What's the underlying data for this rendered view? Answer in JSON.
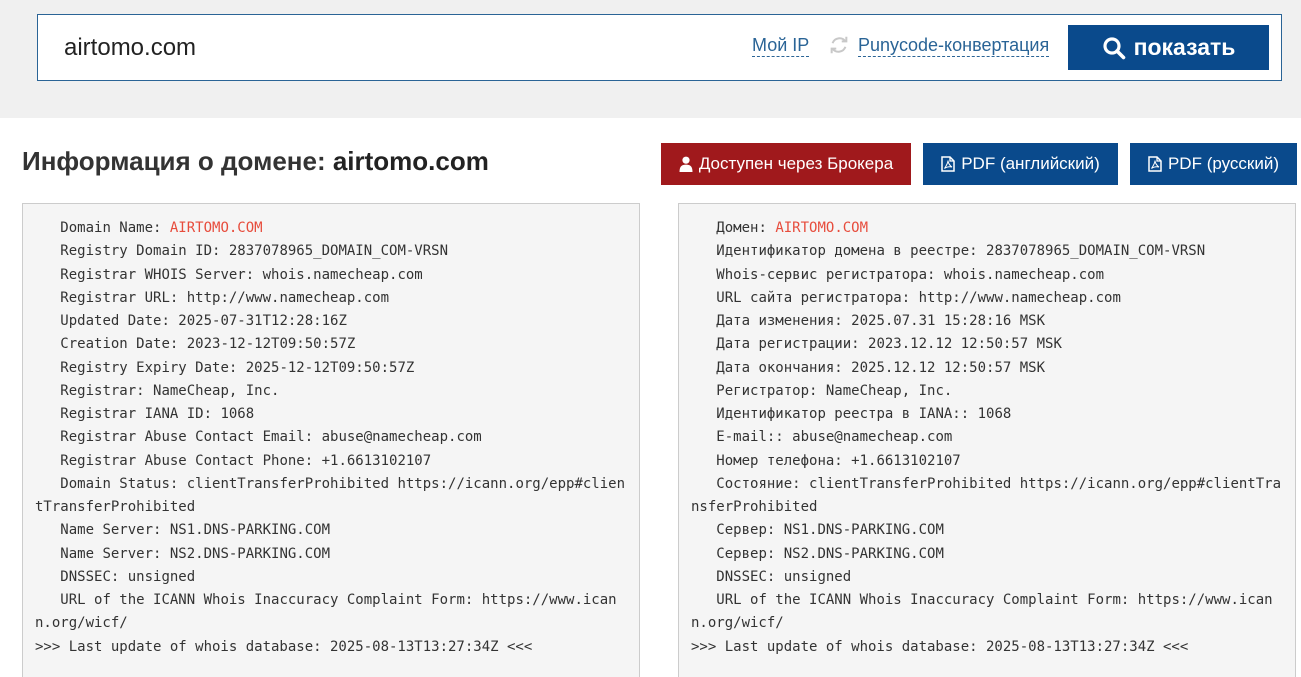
{
  "search": {
    "value": "airtomo.com",
    "my_ip_label": "Мой IP",
    "punycode_label": "Punycode-конвертация",
    "show_label": "показать"
  },
  "header": {
    "title_prefix": "Информация о домене: ",
    "domain": "airtomo.com"
  },
  "actions": {
    "broker_label": "Доступен через Брокера",
    "pdf_en_label": "PDF (английский)",
    "pdf_ru_label": "PDF (русский)"
  },
  "whois_en": {
    "domain_name_key": "   Domain Name: ",
    "domain_name_value": "AIRTOMO.COM",
    "lines": [
      "   Registry Domain ID: 2837078965_DOMAIN_COM-VRSN",
      "   Registrar WHOIS Server: whois.namecheap.com",
      "   Registrar URL: http://www.namecheap.com",
      "   Updated Date: 2025-07-31T12:28:16Z",
      "   Creation Date: 2023-12-12T09:50:57Z",
      "   Registry Expiry Date: 2025-12-12T09:50:57Z",
      "   Registrar: NameCheap, Inc.",
      "   Registrar IANA ID: 1068",
      "   Registrar Abuse Contact Email: abuse@namecheap.com",
      "   Registrar Abuse Contact Phone: +1.6613102107",
      "   Domain Status: clientTransferProhibited https://icann.org/epp#clientTransferProhibited",
      "   Name Server: NS1.DNS-PARKING.COM",
      "   Name Server: NS2.DNS-PARKING.COM",
      "   DNSSEC: unsigned",
      "   URL of the ICANN Whois Inaccuracy Complaint Form: https://www.icann.org/wicf/",
      ">>> Last update of whois database: 2025-08-13T13:27:34Z <<<"
    ]
  },
  "whois_ru": {
    "domain_name_key": "   Домен: ",
    "domain_name_value": "AIRTOMO.COM",
    "lines": [
      "   Идентификатор домена в реестре: 2837078965_DOMAIN_COM-VRSN",
      "   Whois-сервис регистратора: whois.namecheap.com",
      "   URL сайта регистратора: http://www.namecheap.com",
      "   Дата изменения: 2025.07.31 15:28:16 MSK",
      "   Дата регистрации: 2023.12.12 12:50:57 MSK",
      "   Дата окончания: 2025.12.12 12:50:57 MSK",
      "   Регистратор: NameCheap, Inc.",
      "   Идентификатор реестра в IANA:: 1068",
      "   E-mail:: abuse@namecheap.com",
      "   Номер телефона: +1.6613102107",
      "   Состояние: clientTransferProhibited https://icann.org/epp#clientTransferProhibited",
      "   Сервер: NS1.DNS-PARKING.COM",
      "   Сервер: NS2.DNS-PARKING.COM",
      "   DNSSEC: unsigned",
      "   URL of the ICANN Whois Inaccuracy Complaint Form: https://www.icann.org/wicf/",
      ">>> Last update of whois database: 2025-08-13T13:27:34Z <<<"
    ]
  }
}
